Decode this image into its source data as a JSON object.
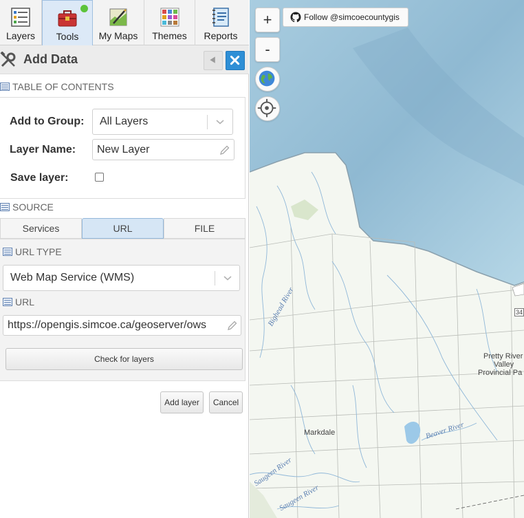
{
  "nav": {
    "tabs": [
      {
        "label": "Layers",
        "icon": "layers-icon"
      },
      {
        "label": "Tools",
        "icon": "toolbox-icon",
        "active": true,
        "status_dot": "#5cc33b"
      },
      {
        "label": "My Maps",
        "icon": "my-maps-icon"
      },
      {
        "label": "Themes",
        "icon": "themes-icon"
      },
      {
        "label": "Reports",
        "icon": "reports-icon"
      }
    ]
  },
  "title_bar": {
    "title": "Add Data",
    "back_icon": "triangle-left-icon",
    "close_icon": "close-icon"
  },
  "toc": {
    "header": "TABLE OF CONTENTS",
    "add_to_group_label": "Add to Group:",
    "add_to_group_value": "All Layers",
    "layer_name_label": "Layer Name:",
    "layer_name_value": "New Layer",
    "save_layer_label": "Save layer:",
    "save_layer_checked": false
  },
  "source": {
    "header": "SOURCE",
    "tabs": [
      "Services",
      "URL",
      "FILE"
    ],
    "active_tab": "URL",
    "url_type_header": "URL TYPE",
    "url_type_value": "Web Map Service (WMS)",
    "url_header": "URL",
    "url_value": "https://opengis.simcoe.ca/geoserver/ows",
    "check_button": "Check for layers"
  },
  "actions": {
    "add_layer": "Add layer",
    "cancel": "Cancel"
  },
  "map": {
    "zoom_in": "+",
    "zoom_out": "-",
    "github_button": "Follow @simcoecountygis",
    "labels": {
      "town": "Markdale",
      "park_line1": "Pretty River",
      "park_line2": "Valley",
      "park_line3": "Provincial Pa",
      "route": "34"
    },
    "rivers": [
      "Bighead River",
      "Beaver River",
      "Saugeen River",
      "Saugeen River"
    ],
    "colors": {
      "water": "#9cc3d9",
      "land": "#f4f7f1",
      "accent": "#2e8fd6"
    }
  }
}
